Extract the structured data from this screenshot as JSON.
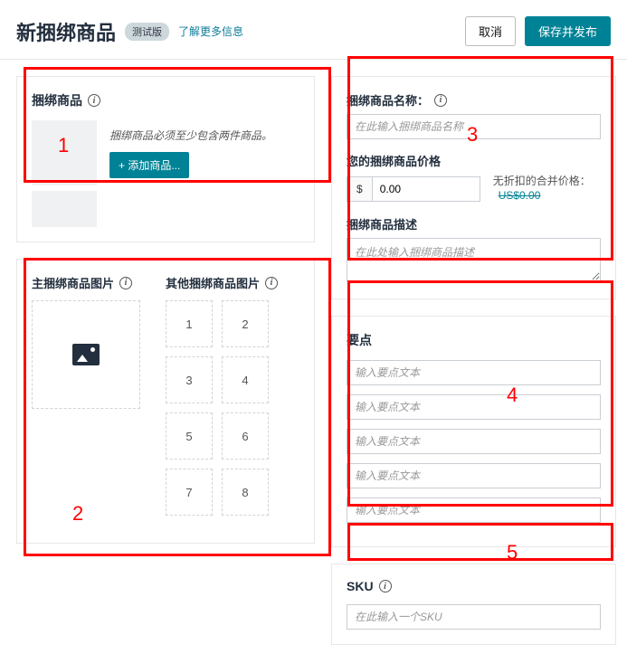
{
  "header": {
    "title": "新捆绑商品",
    "badge": "测试版",
    "learn_more": "了解更多信息",
    "cancel": "取消",
    "save_publish": "保存并发布"
  },
  "bundle_products": {
    "heading": "捆绑商品",
    "message": "捆绑商品必须至少包含两件商品。",
    "add_button": "+ 添加商品..."
  },
  "images": {
    "main_heading": "主捆绑商品图片",
    "other_heading": "其他捆绑商品图片",
    "slots": [
      "1",
      "2",
      "3",
      "4",
      "5",
      "6",
      "7",
      "8"
    ]
  },
  "details": {
    "name_label": "捆绑商品名称：",
    "name_placeholder": "在此输入捆绑商品名称",
    "price_label": "您的捆绑商品价格",
    "currency": "$",
    "price_value": "0.00",
    "combined_label": "无折扣的合并价格：",
    "combined_price": "US$0.00",
    "desc_label": "捆绑商品描述",
    "desc_placeholder": "在此处输入捆绑商品描述"
  },
  "bullets": {
    "heading": "要点",
    "placeholder": "输入要点文本",
    "count": 5
  },
  "sku": {
    "heading": "SKU",
    "placeholder": "在此输入一个SKU"
  },
  "annotations": {
    "1": "1",
    "2": "2",
    "3": "3",
    "4": "4",
    "5": "5"
  }
}
